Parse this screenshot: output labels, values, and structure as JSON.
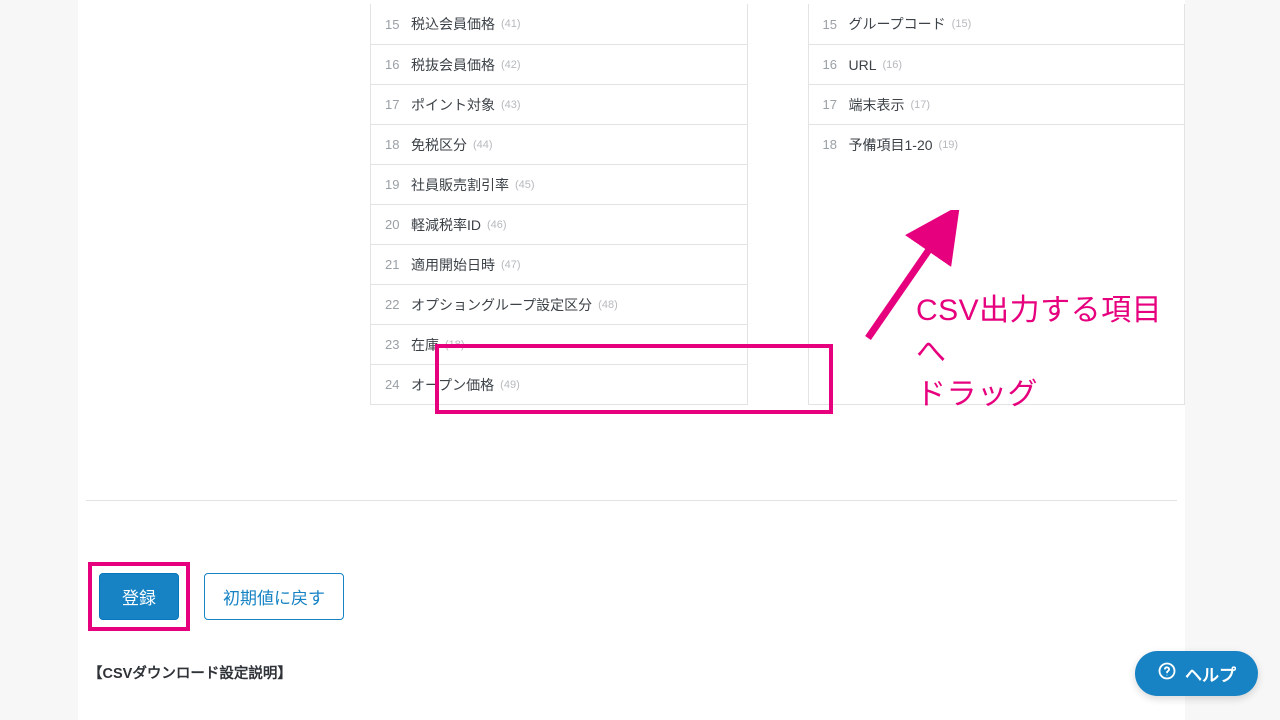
{
  "leftList": [
    {
      "idx": "15",
      "label": "税込会員価格",
      "paren": "(41)"
    },
    {
      "idx": "16",
      "label": "税抜会員価格",
      "paren": "(42)"
    },
    {
      "idx": "17",
      "label": "ポイント対象",
      "paren": "(43)"
    },
    {
      "idx": "18",
      "label": "免税区分",
      "paren": "(44)"
    },
    {
      "idx": "19",
      "label": "社員販売割引率",
      "paren": "(45)"
    },
    {
      "idx": "20",
      "label": "軽減税率ID",
      "paren": "(46)"
    },
    {
      "idx": "21",
      "label": "適用開始日時",
      "paren": "(47)"
    },
    {
      "idx": "22",
      "label": "オプショングループ設定区分",
      "paren": "(48)"
    },
    {
      "idx": "23",
      "label": "在庫",
      "paren": "(18)"
    },
    {
      "idx": "24",
      "label": "オープン価格",
      "paren": "(49)"
    }
  ],
  "rightList": [
    {
      "idx": "15",
      "label": "グループコード",
      "paren": "(15)"
    },
    {
      "idx": "16",
      "label": "URL",
      "paren": "(16)"
    },
    {
      "idx": "17",
      "label": "端末表示",
      "paren": "(17)"
    },
    {
      "idx": "18",
      "label": "予備項目1-20",
      "paren": "(19)"
    }
  ],
  "annotation": {
    "line1": "CSV出力する項目へ",
    "line2": "ドラッグ"
  },
  "buttons": {
    "register": "登録",
    "reset": "初期値に戻す"
  },
  "sectionTitle": "【CSVダウンロード設定説明】",
  "help": {
    "label": "ヘルプ"
  },
  "colors": {
    "accent": "#e6007e",
    "primary": "#1783c4"
  }
}
